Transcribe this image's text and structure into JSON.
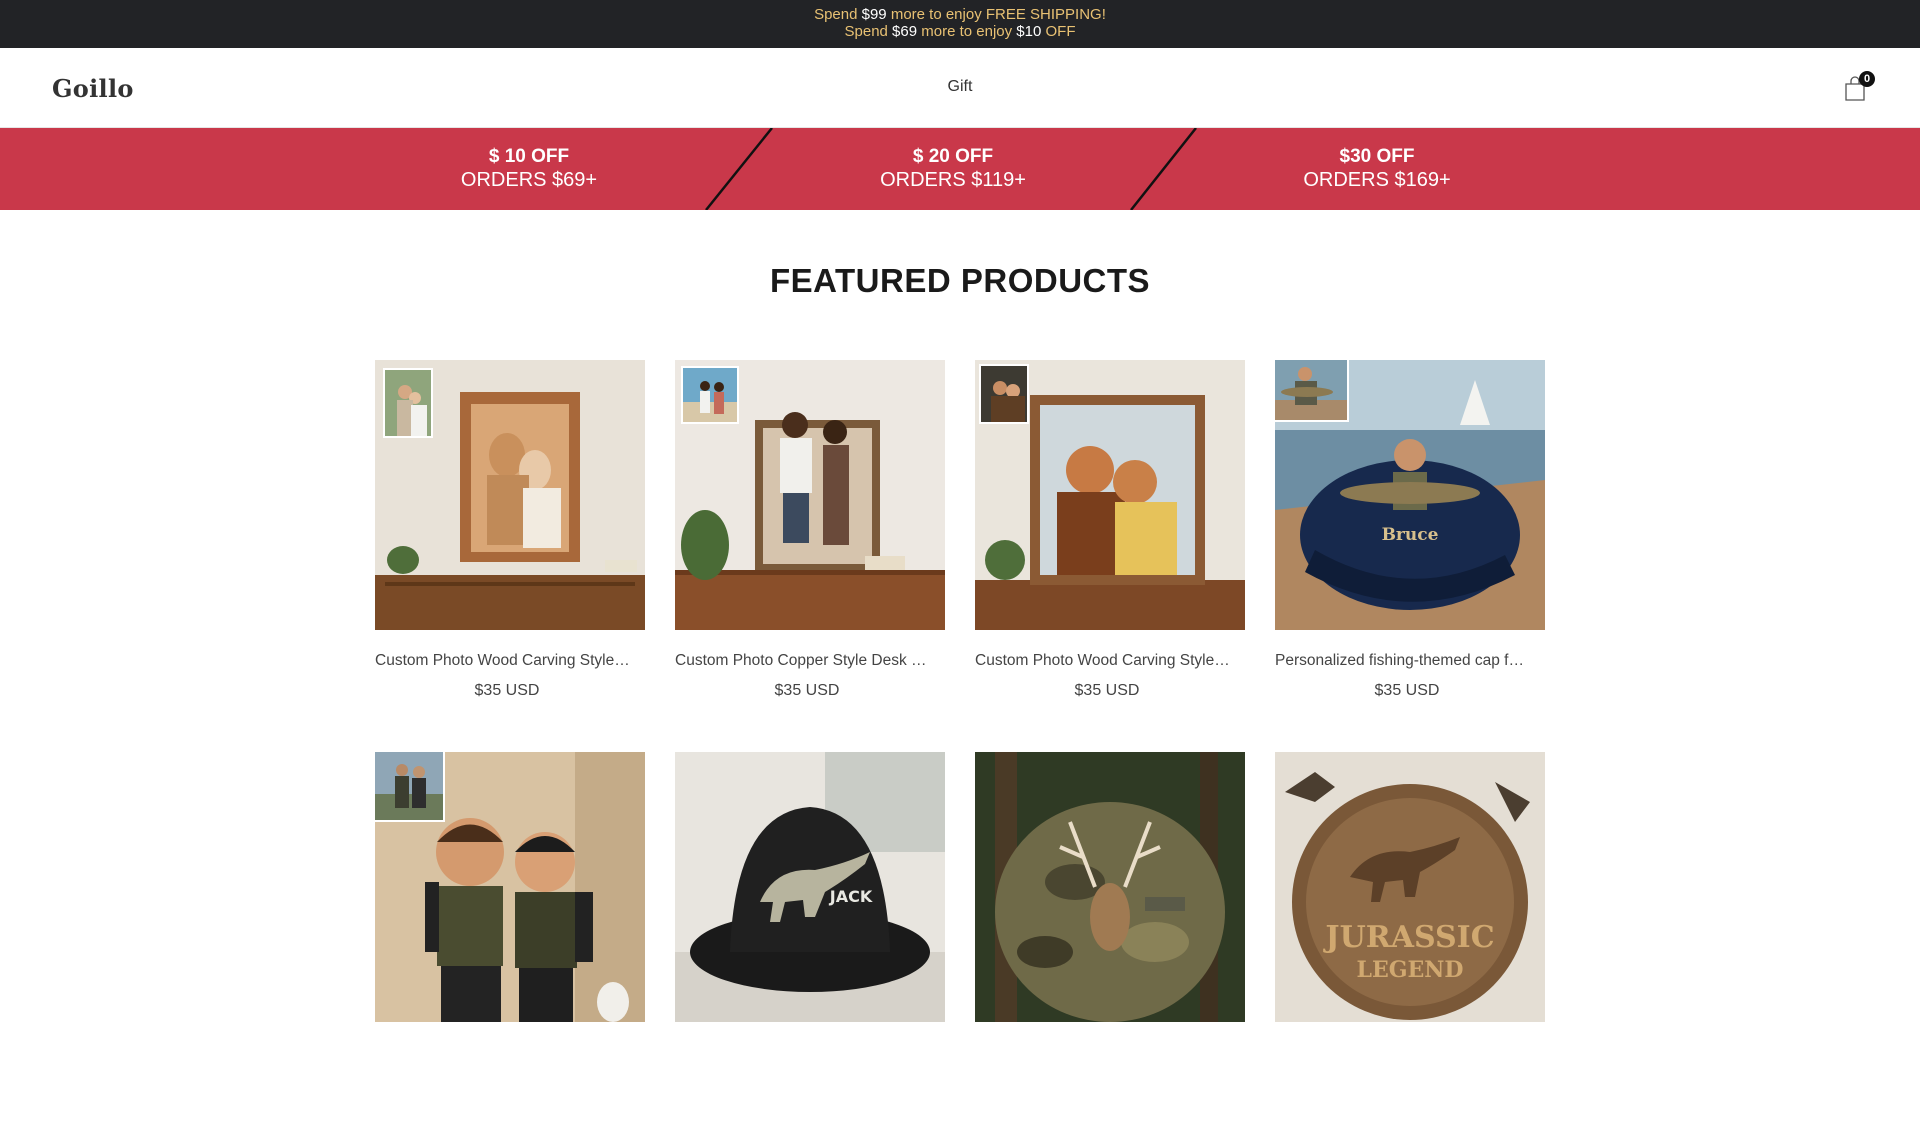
{
  "announcement": {
    "line1": {
      "pre": "Spend ",
      "amount": "$99",
      "post": " more to enjoy FREE SHIPPING!"
    },
    "line2": {
      "pre": "Spend ",
      "amount": "$69",
      "mid": " more to enjoy ",
      "amount2": "$10",
      "post": " OFF"
    }
  },
  "header": {
    "logo": "Goillo",
    "nav": [
      {
        "label": "Gift"
      }
    ],
    "cart_count": "0"
  },
  "promo": {
    "tiers": [
      {
        "line1": "$ 10 OFF",
        "line2": "ORDERS $69+"
      },
      {
        "line1": "$ 20 OFF",
        "line2": "ORDERS $119+"
      },
      {
        "line1": "$30 OFF",
        "line2": "ORDERS $169+"
      }
    ]
  },
  "featured": {
    "title": "FEATURED PRODUCTS",
    "products": [
      {
        "title": "Custom Photo Wood Carving Style…",
        "price": "$35 USD",
        "image": "wood-carving-couple-frame"
      },
      {
        "title": "Custom Photo Copper Style Desk …",
        "price": "$35 USD",
        "image": "copper-couple-statue"
      },
      {
        "title": "Custom Photo Wood Carving Style…",
        "price": "$35 USD",
        "image": "wood-carving-couple-jacket"
      },
      {
        "title": "Personalized fishing-themed cap f…",
        "price": "$35 USD",
        "image": "fishing-cap-bruce",
        "cap_text": "Bruce"
      },
      {
        "title": "",
        "price": "",
        "image": "cartoon-hikers-figurine"
      },
      {
        "title": "",
        "price": "",
        "image": "dinosaur-bucket-hat-jack",
        "cap_text": "JACK"
      },
      {
        "title": "",
        "price": "",
        "image": "deer-camo-cap"
      },
      {
        "title": "",
        "price": "",
        "image": "jurassic-legend-wood-sign",
        "sign_text1": "JURASSIC",
        "sign_text2": "LEGEND"
      }
    ]
  },
  "colors": {
    "announce_bg": "#222326",
    "announce_text": "#e8c173",
    "promo_bg": "#c9384a"
  }
}
